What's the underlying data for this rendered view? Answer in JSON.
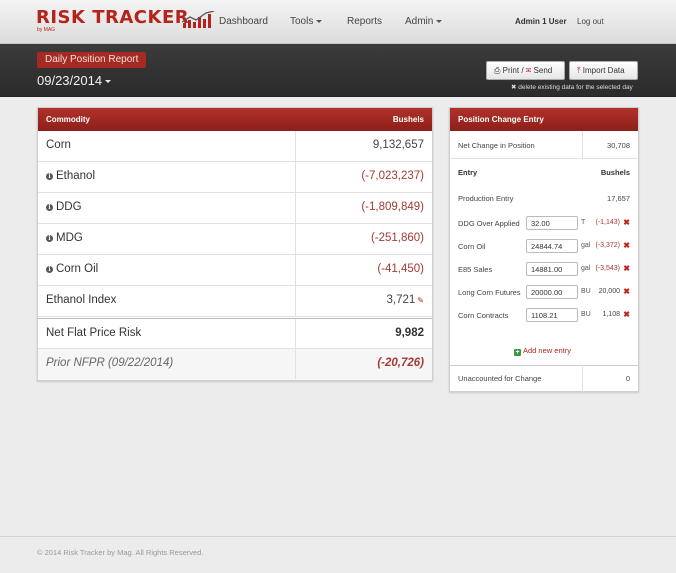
{
  "brand": {
    "name": "RISK TRACKER",
    "sub": "by MAG"
  },
  "nav": {
    "dashboard": "Dashboard",
    "tools": "Tools",
    "reports": "Reports",
    "admin": "Admin"
  },
  "user": {
    "name": "Admin 1 User",
    "logout": "Log out"
  },
  "header": {
    "report_title": "Daily Position Report",
    "date": "09/23/2014",
    "print_label": "Print /",
    "send_label": "Send",
    "import_label": "Import Data",
    "delete_note": "delete existing data for the selected day"
  },
  "commodity_table": {
    "col_commodity": "Commodity",
    "col_bushels": "Bushels",
    "rows": [
      {
        "name": "Corn",
        "value": "9,132,657"
      },
      {
        "name": "Ethanol",
        "value": "(-7,023,237)"
      },
      {
        "name": "DDG",
        "value": "(-1,809,849)"
      },
      {
        "name": "MDG",
        "value": "(-251,860)"
      },
      {
        "name": "Corn Oil",
        "value": "(-41,450)"
      },
      {
        "name": "Ethanol Index",
        "value": "3,721"
      }
    ],
    "nfpr": {
      "name": "Net Flat Price Risk",
      "value": "9,982"
    },
    "prior": {
      "name": "Prior NFPR (09/22/2014)",
      "value": "(-20,726)"
    }
  },
  "position_change": {
    "title": "Position Change Entry",
    "net_change_label": "Net Change in Position",
    "net_change_value": "30,708",
    "col_entry": "Entry",
    "col_bushels": "Bushels",
    "production_label": "Production Entry",
    "production_value": "17,657",
    "entries": [
      {
        "label": "DDG Over Applied",
        "input": "32.00",
        "unit": "T",
        "change": "(-1,143)"
      },
      {
        "label": "Corn Oil",
        "input": "24844.74",
        "unit": "gal",
        "change": "(-3,372)"
      },
      {
        "label": "E85 Sales",
        "input": "14881.00",
        "unit": "gal",
        "change": "(-3,543)"
      },
      {
        "label": "Long Corn Futures",
        "input": "20000.00",
        "unit": "BU",
        "change": "20,000"
      },
      {
        "label": "Corn Contracts",
        "input": "1108.21",
        "unit": "BU",
        "change": "1,108"
      }
    ],
    "add_entry": "Add new entry",
    "unaccounted_label": "Unaccounted for Change",
    "unaccounted_value": "0"
  },
  "footer": {
    "text": "© 2014 Risk Tracker by Mag. All Rights Reserved."
  },
  "colors": {
    "brand_red": "#b5231c",
    "negative_red": "#a33a33",
    "header_dark": "#333333"
  }
}
